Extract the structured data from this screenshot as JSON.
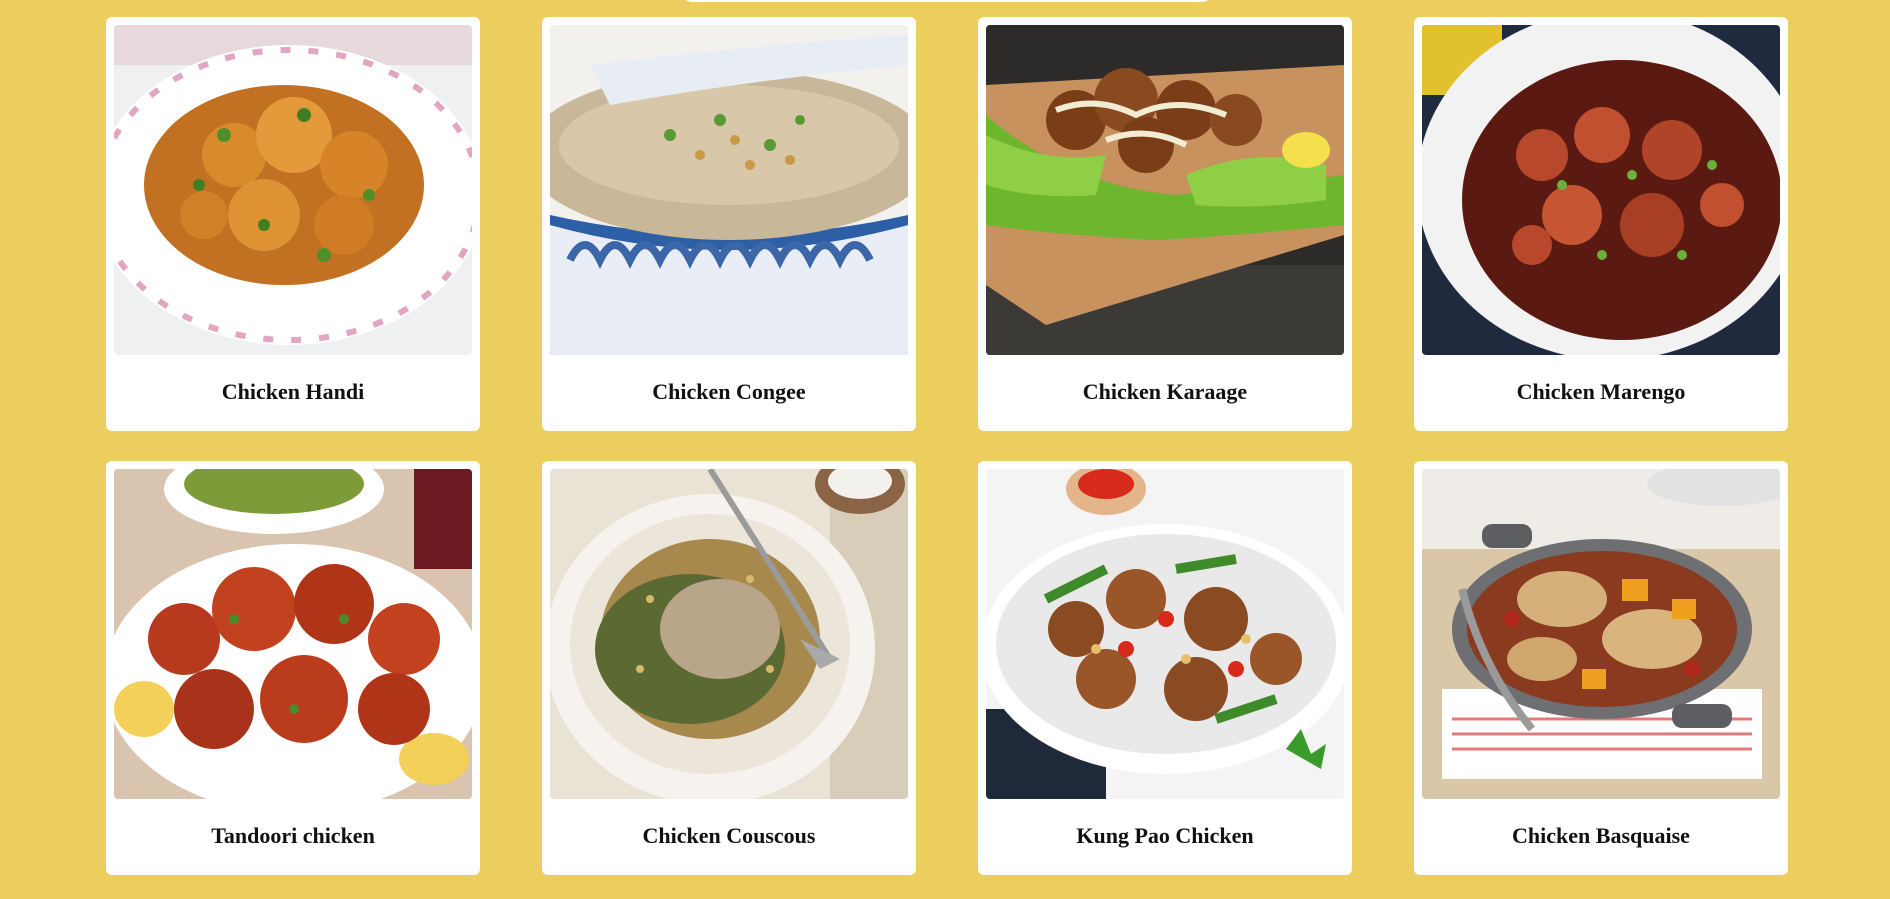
{
  "recipes": [
    {
      "title": "Chicken Handi",
      "dish": "curry in a floral white bowl"
    },
    {
      "title": "Chicken Congee",
      "dish": "rice porridge in a blue and white bowl"
    },
    {
      "title": "Chicken Karaage",
      "dish": "fried chicken on lettuce on a wooden board"
    },
    {
      "title": "Chicken Marengo",
      "dish": "stew in a white casserole"
    },
    {
      "title": "Tandoori chicken",
      "dish": "red roasted chicken pieces on a plate"
    },
    {
      "title": "Chicken Couscous",
      "dish": "chicken on pearl couscous in a white bowl"
    },
    {
      "title": "Kung Pao Chicken",
      "dish": "stir fry with peanuts and chillies"
    },
    {
      "title": "Chicken Basquaise",
      "dish": "chicken with peppers in a grey pan"
    }
  ],
  "colors": {
    "page_background": "#ecce5f",
    "card_background": "#ffffff",
    "title_text": "#111111"
  }
}
